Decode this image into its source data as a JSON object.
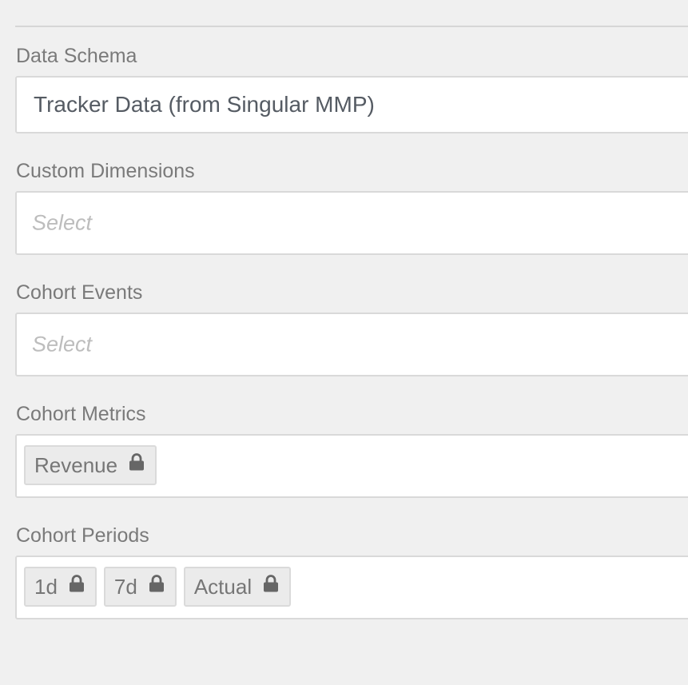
{
  "form": {
    "data_schema": {
      "label": "Data Schema",
      "value": "Tracker Data (from Singular MMP)"
    },
    "custom_dimensions": {
      "label": "Custom Dimensions",
      "placeholder": "Select"
    },
    "cohort_events": {
      "label": "Cohort Events",
      "placeholder": "Select"
    },
    "cohort_metrics": {
      "label": "Cohort Metrics",
      "chips": [
        {
          "label": "Revenue",
          "icon": "lock-icon"
        }
      ]
    },
    "cohort_periods": {
      "label": "Cohort Periods",
      "chips": [
        {
          "label": "1d",
          "icon": "lock-icon"
        },
        {
          "label": "7d",
          "icon": "lock-icon"
        },
        {
          "label": "Actual",
          "icon": "lock-icon"
        }
      ]
    }
  }
}
